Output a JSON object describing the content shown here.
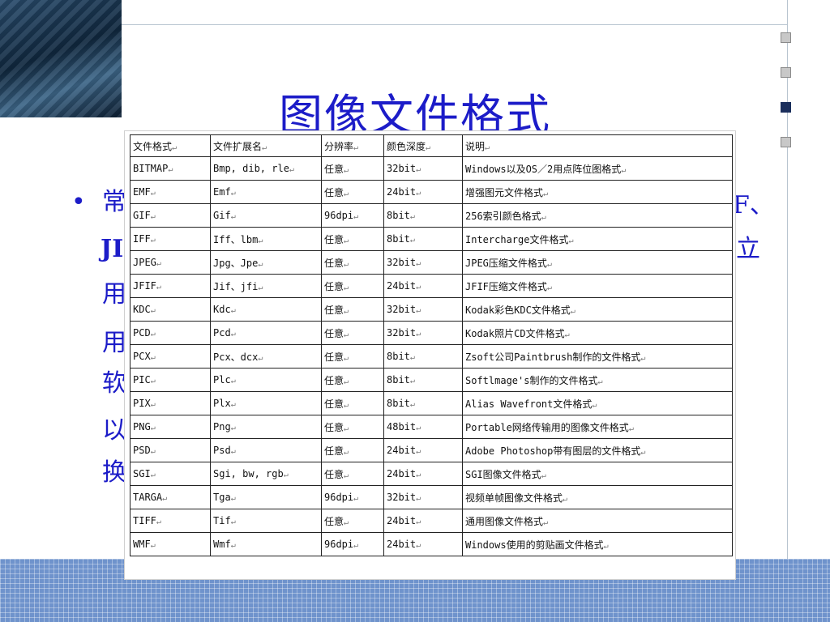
{
  "slide": {
    "title": "图像文件格式",
    "bullet_glyph": "•",
    "partial_left": [
      "常",
      "JI",
      "用",
      "用",
      "软",
      "以",
      "换"
    ],
    "partial_right": [
      "F、",
      "立"
    ]
  },
  "table": {
    "headers": [
      "文件格式",
      "文件扩展名",
      "分辨率",
      "颜色深度",
      "说明"
    ],
    "rows": [
      [
        "BITMAP",
        "Bmp, dib, rle",
        "任意",
        "32bit",
        "Windows以及OS／2用点阵位图格式"
      ],
      [
        "EMF",
        "Emf",
        "任意",
        "24bit",
        "增强图元文件格式"
      ],
      [
        "GIF",
        "Gif",
        "96dpi",
        "8bit",
        "256索引颜色格式"
      ],
      [
        "IFF",
        "Iff、lbm",
        "任意",
        "8bit",
        "Intercharge文件格式"
      ],
      [
        "JPEG",
        "Jpg、Jpe",
        "任意",
        "32bit",
        "JPEG压缩文件格式"
      ],
      [
        "JFIF",
        "Jif、jfi",
        "任意",
        "24bit",
        "JFIF压缩文件格式"
      ],
      [
        "KDC",
        "Kdc",
        "任意",
        "32bit",
        "Kodak彩色KDC文件格式"
      ],
      [
        "PCD",
        "Pcd",
        "任意",
        "32bit",
        "Kodak照片CD文件格式"
      ],
      [
        "PCX",
        "Pcx、dcx",
        "任意",
        "8bit",
        "Zsoft公司Paintbrush制作的文件格式"
      ],
      [
        "PIC",
        "Plc",
        "任意",
        "8bit",
        "Softlmage's制作的文件格式"
      ],
      [
        "PIX",
        "Plx",
        "任意",
        "8bit",
        "Alias Wavefront文件格式"
      ],
      [
        "PNG",
        "Png",
        "任意",
        "48bit",
        "Portable网络传输用的图像文件格式"
      ],
      [
        "PSD",
        "Psd",
        "任意",
        "24bit",
        "Adobe Photoshop带有图层的文件格式"
      ],
      [
        "SGI",
        "Sgi, bw, rgb",
        "任意",
        "24bit",
        "SGI图像文件格式"
      ],
      [
        "TARGA",
        "Tga",
        "96dpi",
        "32bit",
        "视频单帧图像文件格式"
      ],
      [
        "TIFF",
        "Tif",
        "任意",
        "24bit",
        "通用图像文件格式"
      ],
      [
        "WMF",
        "Wmf",
        "96dpi",
        "24bit",
        "Windows使用的剪贴画文件格式"
      ]
    ]
  },
  "colors": {
    "title": "#1c1cc8",
    "band": "#6f93cc",
    "square_active": "#1b2f5c"
  }
}
